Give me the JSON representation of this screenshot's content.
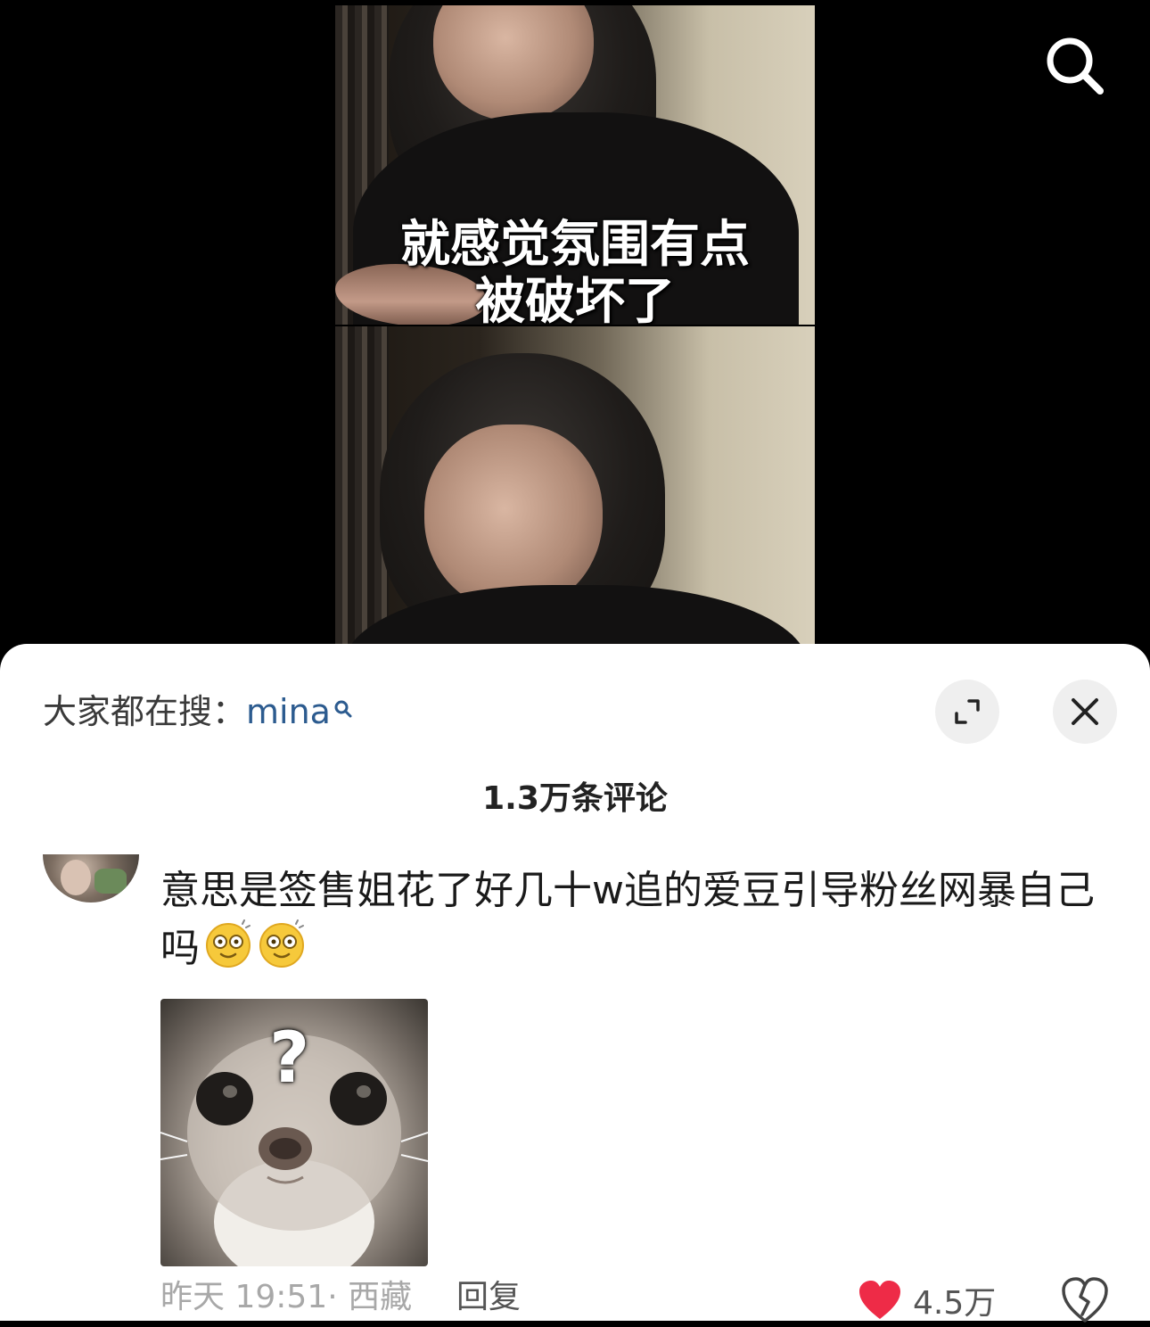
{
  "video": {
    "subtitle_line1": "就感觉氛围有点",
    "subtitle_line2": "被破坏了"
  },
  "top_bar": {
    "search_icon": "search-icon"
  },
  "comments_panel": {
    "trending_label": "大家都在搜：",
    "trending_term": "mina",
    "expand_icon": "expand-icon",
    "close_icon": "close-icon",
    "comment_count": "1.3万条评论"
  },
  "comment": {
    "text": "意思是签售姐花了好几十w追的爱豆引导粉丝网暴自己吗",
    "emojis": [
      "dizzy-face-emoji",
      "dizzy-face-emoji"
    ],
    "image_overlay_text": "?",
    "time": "昨天 19:51",
    "separator": "·",
    "location": "西藏",
    "reply_label": "回复",
    "like_count": "4.5万",
    "liked": true,
    "colors": {
      "like": "#ee2b47",
      "link": "#2c5b8f"
    }
  }
}
